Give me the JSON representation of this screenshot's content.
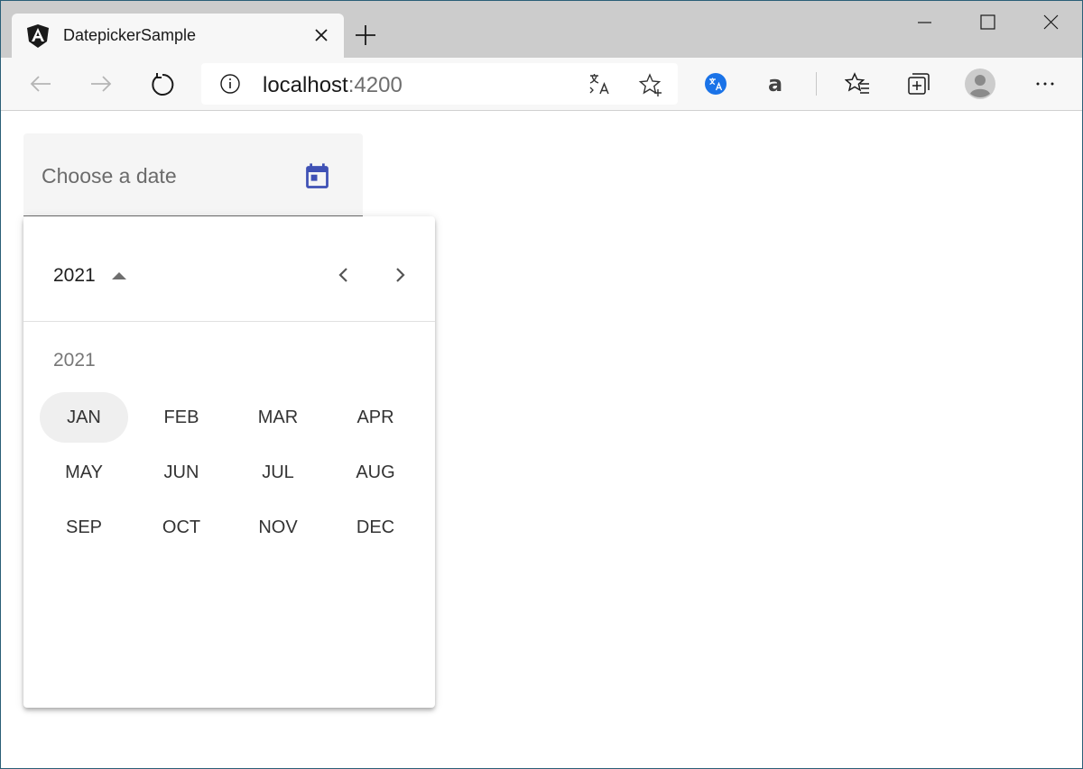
{
  "tab": {
    "title": "DatepickerSample"
  },
  "address": {
    "host": "localhost",
    "port": ":4200"
  },
  "field": {
    "placeholder": "Choose a date"
  },
  "calendar": {
    "period_label": "2021",
    "year_label": "2021",
    "months": [
      [
        "JAN",
        "FEB",
        "MAR",
        "APR"
      ],
      [
        "MAY",
        "JUN",
        "JUL",
        "AUG"
      ],
      [
        "SEP",
        "OCT",
        "NOV",
        "DEC"
      ]
    ],
    "active_month": "JAN"
  },
  "colors": {
    "accent": "#3f51b5",
    "translate_badge": "#1a73e8"
  }
}
